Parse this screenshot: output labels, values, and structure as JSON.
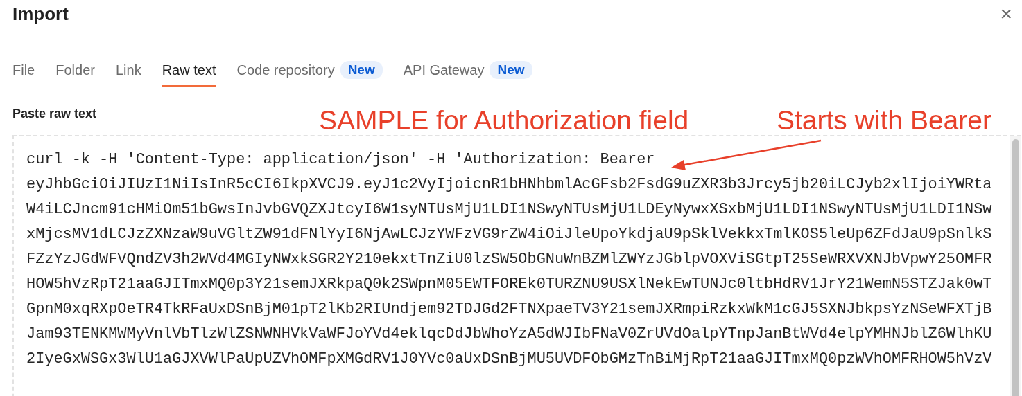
{
  "dialog": {
    "title": "Import",
    "close": "×"
  },
  "tabs": [
    {
      "label": "File",
      "selected": false
    },
    {
      "label": "Folder",
      "selected": false
    },
    {
      "label": "Link",
      "selected": false
    },
    {
      "label": "Raw text",
      "selected": true
    },
    {
      "label": "Code repository",
      "selected": false,
      "badge": "New"
    },
    {
      "label": "API Gateway",
      "selected": false,
      "badge": "New"
    }
  ],
  "field_label": "Paste raw text",
  "annotations": [
    "SAMPLE for Authorization field",
    "Starts with Bearer"
  ],
  "raw_text": [
    "curl -k -H 'Content-Type: application/json' -H 'Authorization: Bearer",
    "eyJhbGciOiJIUzI1NiIsInR5cCI6IkpXVCJ9.eyJ1c2VyIjoicnR1bHNhbmlAcGFsb2FsdG9uZXR3b3Jrcy5jb20iLCJyb2xlIjoiYWRta",
    "W4iLCJncm91cHMiOm51bGwsInJvbGVQZXJtcyI6W1syNTUsMjU1LDI1NSwyNTUsMjU1LDEyNywxXSxbMjU1LDI1NSwyNTUsMjU1LDI1NSw",
    "xMjcsMV1dLCJzZXNzaW9uVGltZW91dFNlYyI6NjAwLCJzYWFzVG9rZW4iOiJleUpoYkdjaU9pSklVekkxTmlKOS5leUp6ZFdJaU9pSnlkS",
    "FZzYzJGdWFVQndZV3h2WVd4MGIyNWxkSGR2Y210ekxtTnZiU0lzSW5ObGNuWnBZMlZWYzJGblpVOXViSGtpT25SeWRXVXNJbVpwY25OMFR",
    "HOW5hVzRpT21aaGJITmxMQ0p3Y21semJXRkpaQ0k2SWpnM05EWTFOREk0TURZNU9USXlNekEwTUNJc0ltbHdRV1JrY21WemN5STZJak0wT",
    "GpnM0xqRXpOeTR4TkRFaUxDSnBjM01pT2lKb2RIUndjem92TDJGd2FTNXpaeTV3Y21semJXRmpiRzkxWkM1cGJ5SXNJbkpsYzNSeWFXTjB",
    "Jam93TENKMWMyVnlVbTlzWlZSNWNHVkVaWFJoYVd4eklqcDdJbWhoYzA5dWJIbFNaV0ZrUVdOalpYTnpJanBtWVd4elpYMHNJblZ6WlhKU",
    "2IyeGxWSGx3WlU1aGJXVWlPaUpUZVhOMFpXMGdRV1J0YVc0aUxDSnBjMU5UVDFObGMzTnBiMjRpT21aaGJITmxMQ0pzWVhOMFRHOW5hVzV"
  ]
}
